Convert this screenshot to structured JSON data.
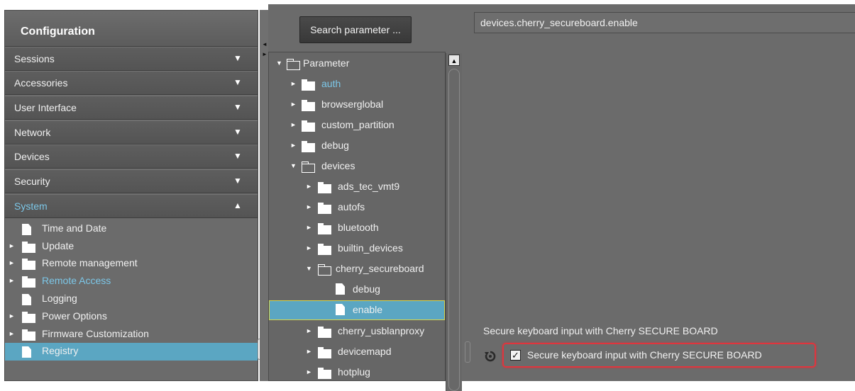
{
  "config": {
    "title": "Configuration",
    "sections": [
      {
        "label": "Sessions",
        "arrow": "▼"
      },
      {
        "label": "Accessories",
        "arrow": "▼"
      },
      {
        "label": "User Interface",
        "arrow": "▼"
      },
      {
        "label": "Network",
        "arrow": "▼"
      },
      {
        "label": "Devices",
        "arrow": "▼"
      },
      {
        "label": "Security",
        "arrow": "▼"
      },
      {
        "label": "System",
        "arrow": "▲"
      }
    ],
    "system_items": [
      {
        "label": "Time and Date",
        "icon": "file-icon"
      },
      {
        "label": "Update",
        "icon": "folder-icon",
        "expander": "►"
      },
      {
        "label": "Remote management",
        "icon": "folder-icon",
        "expander": "►"
      },
      {
        "label": "Remote Access",
        "icon": "folder-icon",
        "expander": "►"
      },
      {
        "label": "Logging",
        "icon": "file-icon"
      },
      {
        "label": "Power Options",
        "icon": "folder-icon",
        "expander": "►"
      },
      {
        "label": "Firmware Customization",
        "icon": "folder-icon",
        "expander": "►"
      },
      {
        "label": "Registry",
        "icon": "file-icon"
      }
    ]
  },
  "search": {
    "label": "Search parameter ..."
  },
  "tree": {
    "root": {
      "label": "Parameter",
      "expander": "▼"
    },
    "nodes": [
      {
        "label": "auth",
        "expander": "►"
      },
      {
        "label": "browserglobal",
        "expander": "►"
      },
      {
        "label": "custom_partition",
        "expander": "►"
      },
      {
        "label": "debug",
        "expander": "►"
      },
      {
        "label": "devices",
        "expander": "▼"
      },
      {
        "label": "ads_tec_vmt9",
        "expander": "►"
      },
      {
        "label": "autofs",
        "expander": "►"
      },
      {
        "label": "bluetooth",
        "expander": "►"
      },
      {
        "label": "builtin_devices",
        "expander": "►"
      },
      {
        "label": "cherry_secureboard",
        "expander": "▼"
      },
      {
        "label": "debug"
      },
      {
        "label": "enable"
      },
      {
        "label": "cherry_usblanproxy",
        "expander": "►"
      },
      {
        "label": "devicemapd",
        "expander": "►"
      },
      {
        "label": "hotplug",
        "expander": "►"
      }
    ]
  },
  "detail": {
    "path": "devices.cherry_secureboard.enable",
    "description": "Secure keyboard input with Cherry SECURE BOARD",
    "checkbox_label": "Secure keyboard input with Cherry SECURE BOARD",
    "checkbox_mark": "✓"
  },
  "colors": {
    "panel_bg": "#6b6b6b",
    "selection": "#5ba6c2",
    "link_blue": "#7cc7e8",
    "highlight_red": "#e0353d"
  }
}
